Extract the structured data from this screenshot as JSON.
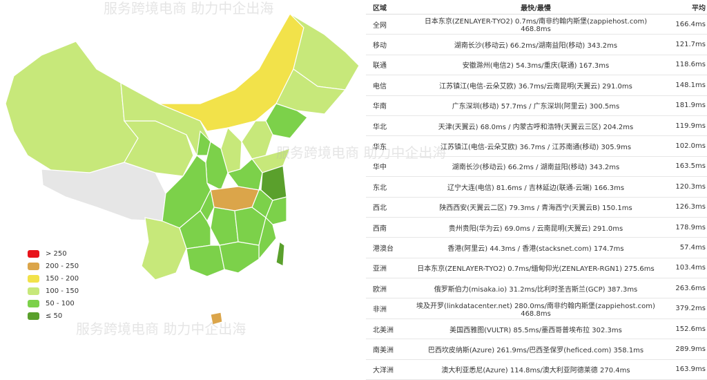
{
  "watermark": "服务跨境电商 助力中企出海",
  "legend": [
    {
      "label": "> 250",
      "color": "#e8141b"
    },
    {
      "label": "200 - 250",
      "color": "#dba54a"
    },
    {
      "label": "150 - 200",
      "color": "#f2e24a"
    },
    {
      "label": "100 - 150",
      "color": "#c7e87a"
    },
    {
      "label": "50 - 100",
      "color": "#7cd14a"
    },
    {
      "label": "≤ 50",
      "color": "#5aa02c"
    }
  ],
  "table": {
    "headers": [
      "区域",
      "最快/最慢",
      "平均"
    ],
    "rows": [
      [
        "全网",
        "日本东京(ZENLAYER-TYO2) 0.7ms/南非约翰内斯堡(zappiehost.com) 468.8ms",
        "166.4ms"
      ],
      [
        "移动",
        "湖南长沙(移动云) 66.2ms/湖南益阳(移动) 343.2ms",
        "121.7ms"
      ],
      [
        "联通",
        "安徽滁州(电信2) 54.3ms/重庆(联通) 167.3ms",
        "118.6ms"
      ],
      [
        "电信",
        "江苏镇江(电信-云朵艾欧) 36.7ms/云南昆明(天翼云) 291.0ms",
        "148.1ms"
      ],
      [
        "华南",
        "广东深圳(移动) 57.7ms / 广东深圳(阿里云) 300.5ms",
        "181.9ms"
      ],
      [
        "华北",
        "天津(天翼云) 68.0ms / 内蒙古呼和浩特(天翼云三区) 204.2ms",
        "119.9ms"
      ],
      [
        "华东",
        "江苏镇江(电信-云朵艾欧) 36.7ms / 江苏南通(移动) 305.9ms",
        "102.0ms"
      ],
      [
        "华中",
        "湖南长沙(移动云) 66.2ms / 湖南益阳(移动) 343.2ms",
        "163.5ms"
      ],
      [
        "东北",
        "辽宁大连(电信) 81.6ms / 吉林延边(联通-云端) 166.3ms",
        "120.3ms"
      ],
      [
        "西北",
        "陕西西安(天翼云二区) 79.3ms / 青海西宁(天翼云B) 150.1ms",
        "126.3ms"
      ],
      [
        "西南",
        "贵州贵阳(华为云) 69.0ms / 云南昆明(天翼云) 291.0ms",
        "178.9ms"
      ],
      [
        "港澳台",
        "香港(阿里云) 44.3ms / 香港(stacksnet.com) 174.7ms",
        "57.4ms"
      ],
      [
        "亚洲",
        "日本东京(ZENLAYER-TYO2) 0.7ms/缅甸仰光(ZENLAYER-RGN1) 275.6ms",
        "103.4ms"
      ],
      [
        "欧洲",
        "俄罗斯伯力(misaka.io) 31.2ms/比利时圣吉斯兰(GCP) 387.3ms",
        "263.6ms"
      ],
      [
        "非洲",
        "埃及开罗(linkdatacenter.net) 280.0ms/南非约翰内斯堡(zappiehost.com) 468.8ms",
        "379.2ms"
      ],
      [
        "北美洲",
        "美国西雅图(VULTR) 85.5ms/墨西哥普埃布拉 302.3ms",
        "152.6ms"
      ],
      [
        "南美洲",
        "巴西坎皮纳斯(Azure) 261.9ms/巴西圣保罗(heficed.com) 358.1ms",
        "289.9ms"
      ],
      [
        "大洋洲",
        "澳大利亚悉尼(Azure) 114.8ms/澳大利亚阿德莱德 270.4ms",
        "163.9ms"
      ]
    ]
  }
}
